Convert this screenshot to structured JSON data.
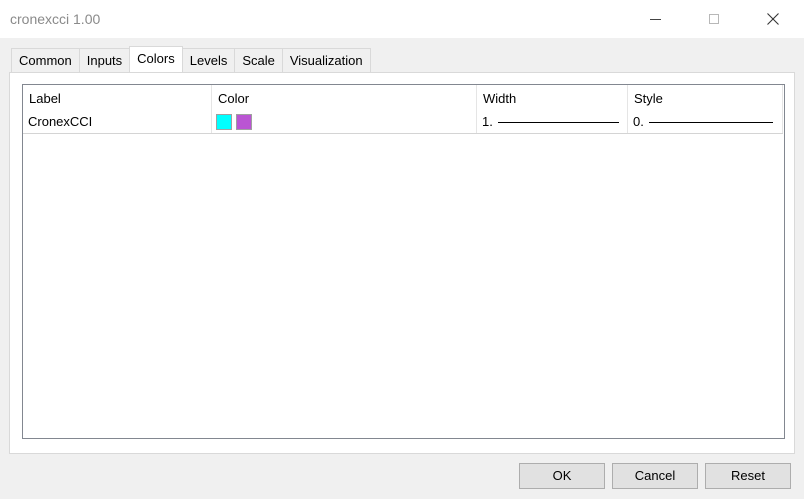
{
  "window": {
    "title": "cronexcci 1.00"
  },
  "tabs": [
    {
      "label": "Common"
    },
    {
      "label": "Inputs"
    },
    {
      "label": "Colors",
      "active": true
    },
    {
      "label": "Levels"
    },
    {
      "label": "Scale"
    },
    {
      "label": "Visualization"
    }
  ],
  "table": {
    "columns": [
      "Label",
      "Color",
      "Width",
      "Style"
    ],
    "rows": [
      {
        "label": "CronexCCI",
        "colors": [
          "#00ffff",
          "#ba55d3"
        ],
        "width": "1.",
        "style": "0."
      }
    ]
  },
  "buttons": {
    "ok": "OK",
    "cancel": "Cancel",
    "reset": "Reset"
  }
}
